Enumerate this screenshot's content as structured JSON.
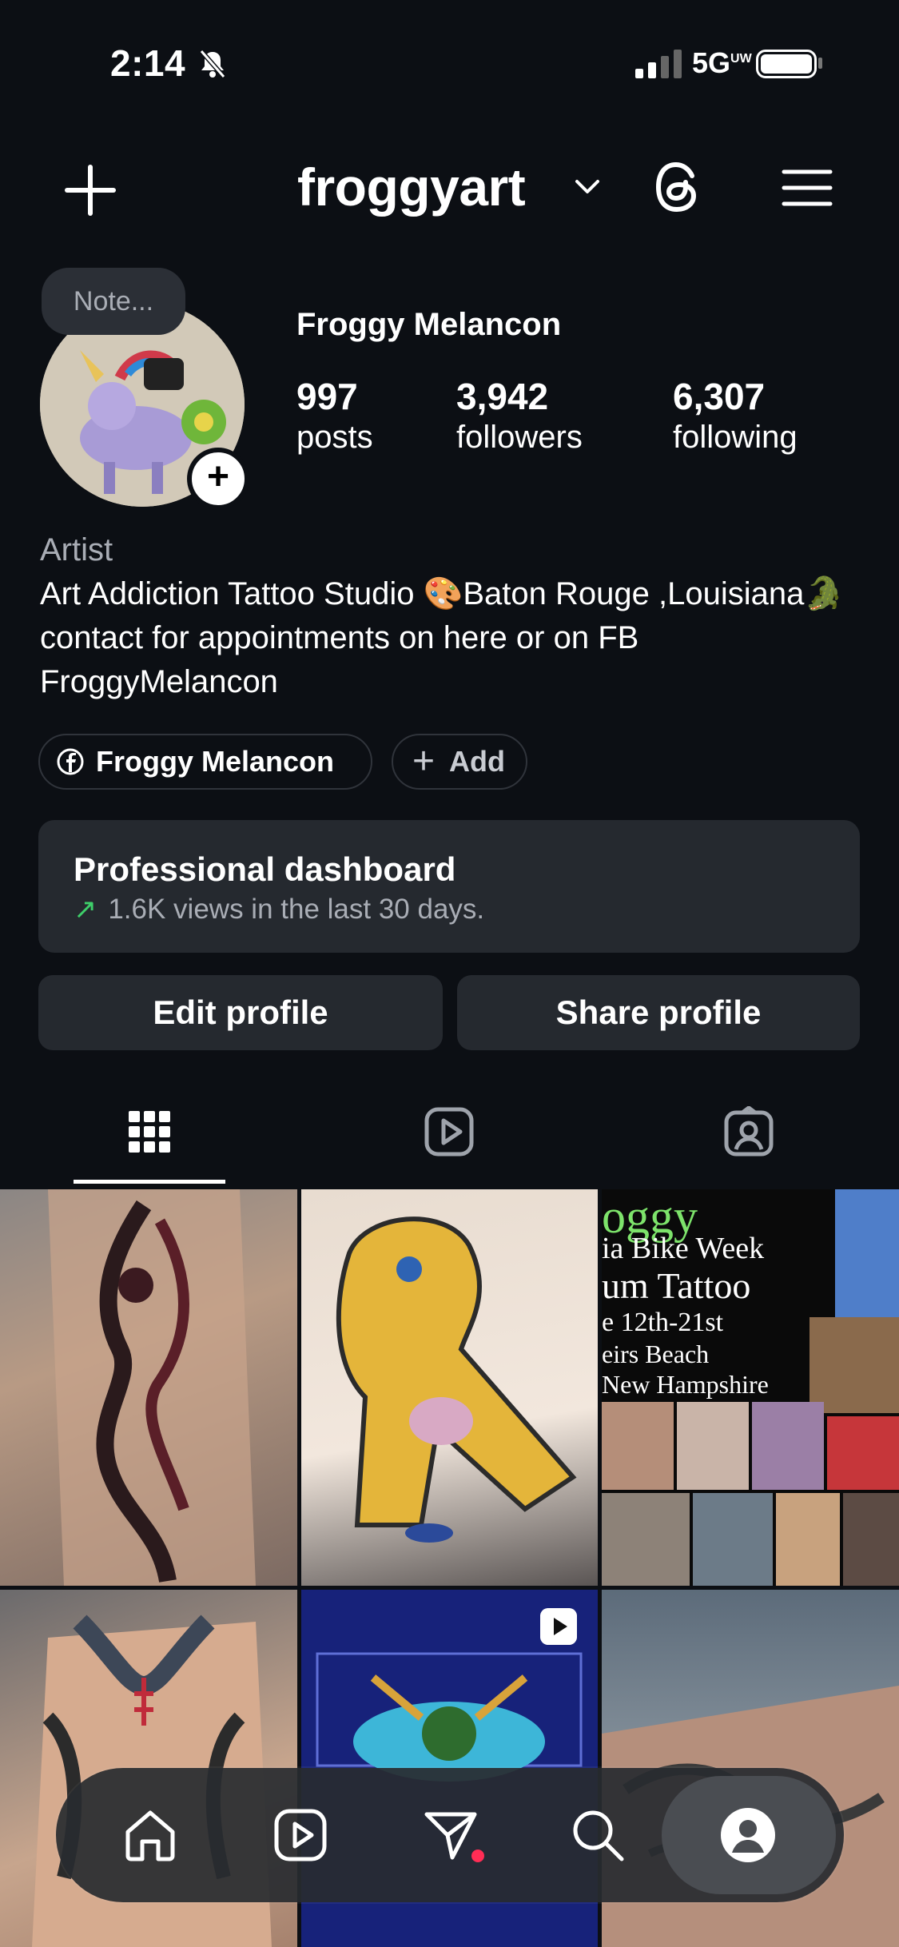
{
  "status": {
    "time": "2:14",
    "network": "5G",
    "network_suffix": "UW"
  },
  "header": {
    "username": "froggyart"
  },
  "profile": {
    "note": "Note...",
    "full_name": "Froggy Melancon",
    "stats": [
      {
        "value": "997",
        "label": "posts"
      },
      {
        "value": "3,942",
        "label": "followers"
      },
      {
        "value": "6,307",
        "label": "following"
      }
    ],
    "category": "Artist",
    "bio": "Art Addiction Tattoo Studio 🎨Baton Rouge ,Louisiana🐊contact for appointments on here or on FB FroggyMelancon",
    "links": [
      {
        "label": "Froggy Melancon",
        "icon": "facebook-icon"
      },
      {
        "label": "Add",
        "icon": "plus-icon"
      }
    ]
  },
  "dashboard": {
    "title": "Professional dashboard",
    "subtitle": "1.6K views in the last 30 days."
  },
  "actions": {
    "edit": "Edit profile",
    "share": "Share profile"
  },
  "tabs": [
    {
      "icon": "grid-icon",
      "selected": true
    },
    {
      "icon": "reels-icon",
      "selected": false
    },
    {
      "icon": "tagged-icon",
      "selected": false
    }
  ],
  "poster": {
    "lines": [
      "oggy",
      "ia Bike Week",
      "um Tattoo",
      "e 12th-21st",
      "eirs Beach",
      " New Hampshire"
    ]
  },
  "bottom_nav": [
    {
      "icon": "home-icon"
    },
    {
      "icon": "reels-icon"
    },
    {
      "icon": "messages-icon"
    },
    {
      "icon": "search-icon"
    },
    {
      "icon": "profile-icon",
      "selected": true
    }
  ],
  "colors": {
    "background": "#0c0f14",
    "card": "#25292f",
    "accent_green": "#3ecf6a",
    "notification_dot": "#ff2d55"
  }
}
